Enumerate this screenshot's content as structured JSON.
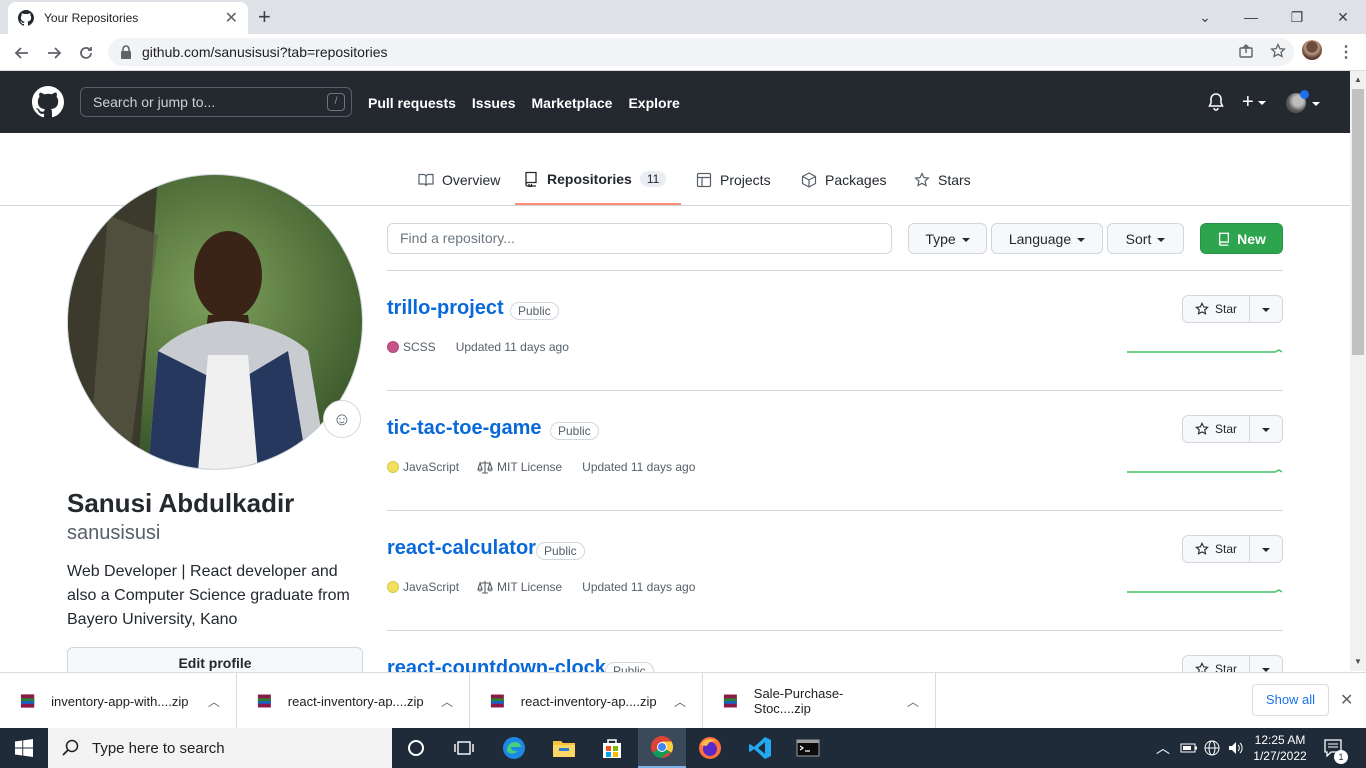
{
  "browser": {
    "tab_title": "Your Repositories",
    "url": "github.com/sanusisusi?tab=repositories"
  },
  "gh_header": {
    "search_placeholder": "Search or jump to...",
    "search_shortcut": "/",
    "nav": [
      "Pull requests",
      "Issues",
      "Marketplace",
      "Explore"
    ]
  },
  "profile_tabs": [
    {
      "label": "Overview",
      "icon": "book-icon"
    },
    {
      "label": "Repositories",
      "icon": "repo-icon",
      "count": "11",
      "active": true
    },
    {
      "label": "Projects",
      "icon": "table-icon"
    },
    {
      "label": "Packages",
      "icon": "package-icon"
    },
    {
      "label": "Stars",
      "icon": "star-icon"
    }
  ],
  "profile": {
    "full_name": "Sanusi Abdulkadir",
    "username": "sanusisusi",
    "bio": "Web Developer | React developer and also a Computer Science graduate from Bayero University, Kano",
    "edit_label": "Edit profile"
  },
  "filters": {
    "find_placeholder": "Find a repository...",
    "type_label": "Type",
    "language_label": "Language",
    "sort_label": "Sort",
    "new_label": "New"
  },
  "repos": [
    {
      "name": "trillo-project",
      "visibility": "Public",
      "language": "SCSS",
      "lang_color": "#c6538c",
      "license": "",
      "updated": "Updated 11 days ago",
      "star_label": "Star"
    },
    {
      "name": "tic-tac-toe-game",
      "visibility": "Public",
      "language": "JavaScript",
      "lang_color": "#f1e05a",
      "license": "MIT License",
      "updated": "Updated 11 days ago",
      "star_label": "Star"
    },
    {
      "name": "react-calculator",
      "visibility": "Public",
      "language": "JavaScript",
      "lang_color": "#f1e05a",
      "license": "MIT License",
      "updated": "Updated 11 days ago",
      "star_label": "Star"
    },
    {
      "name": "react-countdown-clock",
      "visibility": "Public",
      "language": "",
      "lang_color": "",
      "license": "",
      "updated": "",
      "star_label": "Star"
    }
  ],
  "downloads": {
    "items": [
      "inventory-app-with....zip",
      "react-inventory-ap....zip",
      "react-inventory-ap....zip",
      "Sale-Purchase-Stoc....zip"
    ],
    "show_all": "Show all"
  },
  "taskbar": {
    "search_placeholder": "Type here to search",
    "time": "12:25 AM",
    "date": "1/27/2022",
    "notification_count": "1"
  }
}
